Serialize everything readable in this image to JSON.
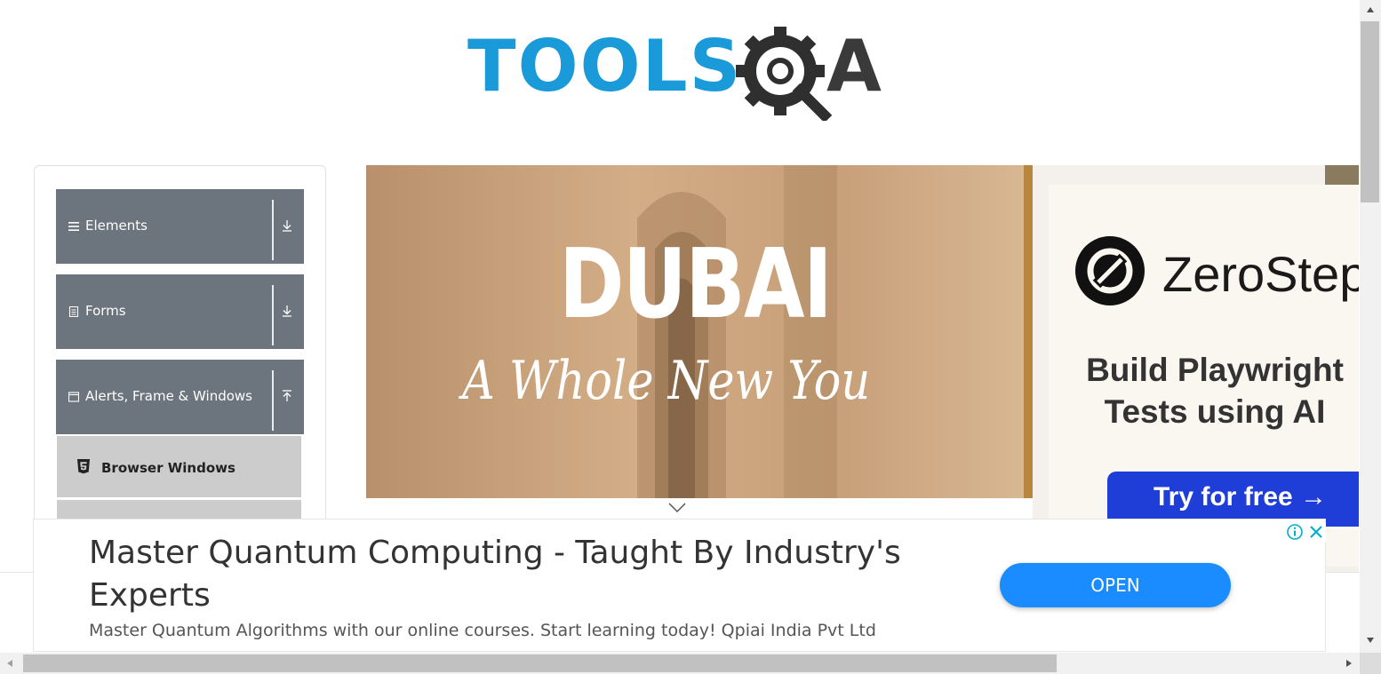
{
  "header": {
    "logo_text": "TOOLS",
    "logo_suffix": "A"
  },
  "sidebar": {
    "groups": [
      {
        "label": "Elements",
        "icon": "hamburger-icon",
        "toggle": "download-arrow-icon"
      },
      {
        "label": "Forms",
        "icon": "document-icon",
        "toggle": "download-arrow-icon"
      },
      {
        "label": "Alerts, Frame & Windows",
        "icon": "window-icon",
        "toggle": "upload-arrow-icon"
      }
    ],
    "active_item": {
      "label": "Browser Windows",
      "icon": "html5-icon"
    }
  },
  "banner_ad": {
    "title": "DUBAI",
    "subtitle": "A Whole New You"
  },
  "side_ad": {
    "brand": "ZeroStep",
    "line1": "Build Playwright",
    "line2": "Tests using AI",
    "cta": "Try for free →",
    "accent": "#1f3ed8"
  },
  "bottom_ad": {
    "title": "Master Quantum Computing - Taught By Industry's Experts",
    "description": "Master Quantum Algorithms with our online courses. Start learning today! Qpiai India Pvt Ltd",
    "cta": "OPEN",
    "accent": "#1a8cff"
  },
  "colors": {
    "logo_blue": "#1a9ad9",
    "logo_dark": "#3a3a3a",
    "sidebar_header": "#6c757d",
    "active_item": "#cccccc"
  }
}
